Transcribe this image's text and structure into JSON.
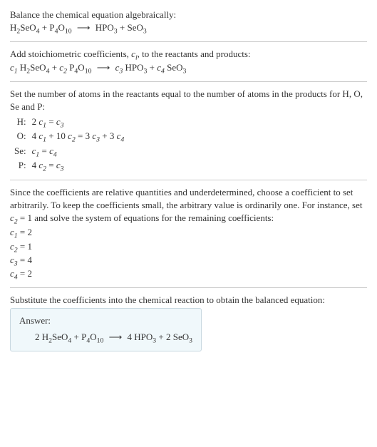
{
  "intro": {
    "line1": "Balance the chemical equation algebraically:",
    "eq_lhs1": "H",
    "eq_lhs1_sub": "2",
    "eq_lhs2": "SeO",
    "eq_lhs2_sub": "4",
    "plus1": " + ",
    "eq_lhs3": "P",
    "eq_lhs3_sub": "4",
    "eq_lhs4": "O",
    "eq_lhs4_sub": "10",
    "arrow": "⟶",
    "eq_rhs1": "HPO",
    "eq_rhs1_sub": "3",
    "plus2": " + ",
    "eq_rhs2": "SeO",
    "eq_rhs2_sub": "3"
  },
  "stoich": {
    "text_a": "Add stoichiometric coefficients, ",
    "ci": "c",
    "ci_sub": "i",
    "text_b": ", to the reactants and products:",
    "c1": "c",
    "c1s": "1",
    "sp1": " ",
    "r1a": "H",
    "r1as": "2",
    "r1b": "SeO",
    "r1bs": "4",
    "plus1": " + ",
    "c2": "c",
    "c2s": "2",
    "sp2": " ",
    "r2a": "P",
    "r2as": "4",
    "r2b": "O",
    "r2bs": "10",
    "arrow": "⟶",
    "c3": "c",
    "c3s": "3",
    "sp3": " ",
    "p1a": "HPO",
    "p1as": "3",
    "plus2": " + ",
    "c4": "c",
    "c4s": "4",
    "sp4": " ",
    "p2a": "SeO",
    "p2as": "3"
  },
  "atoms": {
    "intro": "Set the number of atoms in the reactants equal to the number of atoms in the products for H, O, Se and P:",
    "rows": [
      {
        "el": "H:",
        "lhs_a": "2 ",
        "c_l": "c",
        "cs_l": "1",
        "mid": " = ",
        "c_r": "c",
        "cs_r": "3",
        "tail": ""
      },
      {
        "el": "O:",
        "lhs_a": "4 ",
        "c_l": "c",
        "cs_l": "1",
        "mid": " + 10 ",
        "c_m": "c",
        "cs_m": "2",
        "eq": " = 3 ",
        "c_r": "c",
        "cs_r": "3",
        "plus": " + 3 ",
        "c_r2": "c",
        "cs_r2": "4"
      },
      {
        "el": "Se:",
        "lhs_a": "",
        "c_l": "c",
        "cs_l": "1",
        "mid": " = ",
        "c_r": "c",
        "cs_r": "4",
        "tail": ""
      },
      {
        "el": "P:",
        "lhs_a": "4 ",
        "c_l": "c",
        "cs_l": "2",
        "mid": " = ",
        "c_r": "c",
        "cs_r": "3",
        "tail": ""
      }
    ]
  },
  "choose": {
    "para_a": "Since the coefficients are relative quantities and underdetermined, choose a coefficient to set arbitrarily. To keep the coefficients small, the arbitrary value is ordinarily one. For instance, set ",
    "cv": "c",
    "cvs": "2",
    "para_b": " = 1 and solve the system of equations for the remaining coefficients:",
    "lines": [
      {
        "c": "c",
        "cs": "1",
        "rest": " = 2"
      },
      {
        "c": "c",
        "cs": "2",
        "rest": " = 1"
      },
      {
        "c": "c",
        "cs": "3",
        "rest": " = 4"
      },
      {
        "c": "c",
        "cs": "4",
        "rest": " = 2"
      }
    ]
  },
  "subst": {
    "text": "Substitute the coefficients into the chemical reaction to obtain the balanced equation:"
  },
  "answer": {
    "label": "Answer:",
    "n1": "2 ",
    "r1a": "H",
    "r1as": "2",
    "r1b": "SeO",
    "r1bs": "4",
    "plus1": " + ",
    "r2a": "P",
    "r2as": "4",
    "r2b": "O",
    "r2bs": "10",
    "arrow": "⟶",
    "n3": "4 ",
    "p1a": "HPO",
    "p1as": "3",
    "plus2": " + ",
    "n4": "2 ",
    "p2a": "SeO",
    "p2as": "3"
  }
}
